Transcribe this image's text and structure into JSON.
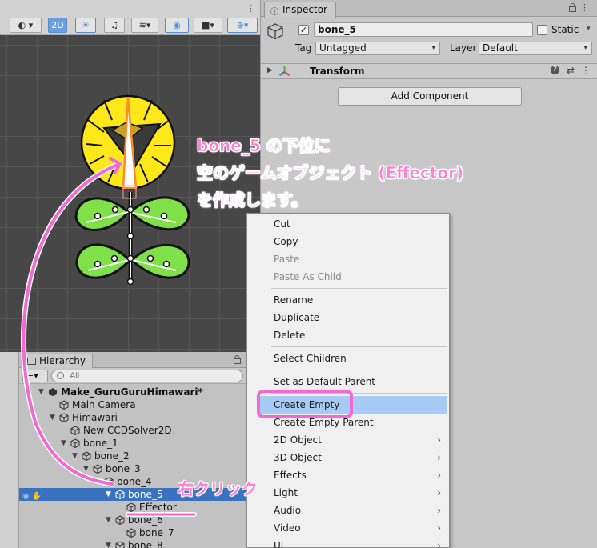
{
  "scene": {
    "toolbar": {
      "shading": "◐",
      "mode_2d": "2D",
      "lighting_icon": "lightbulb-icon",
      "audio_icon": "audio-mute-icon",
      "fx_icon": "effects-icon",
      "hidden_icon": "visibility-icon",
      "camera_icon": "camera-icon",
      "gizmo_icon": "gizmo-icon"
    }
  },
  "inspector": {
    "tab_label": "Inspector",
    "object_name": "bone_5",
    "active_checked": "✓",
    "static_label": "Static",
    "tag_label": "Tag",
    "tag_value": "Untagged",
    "layer_label": "Layer",
    "layer_value": "Default",
    "component_title": "Transform",
    "help_glyph": "?",
    "preset_glyph": "⇄",
    "menu_glyph": "⋮",
    "add_component_label": "Add Component"
  },
  "hierarchy": {
    "tab_label": "Hierarchy",
    "add_label": "+▾",
    "search_placeholder": "All",
    "rows": [
      {
        "label": "Make_GuruGuruHimawari*",
        "depth": 0,
        "expanded": true
      },
      {
        "label": "Main Camera",
        "depth": 1,
        "expanded": null
      },
      {
        "label": "Himawari",
        "depth": 1,
        "expanded": true
      },
      {
        "label": "New CCDSolver2D",
        "depth": 2,
        "expanded": null
      },
      {
        "label": "bone_1",
        "depth": 2,
        "expanded": true
      },
      {
        "label": "bone_2",
        "depth": 3,
        "expanded": true
      },
      {
        "label": "bone_3",
        "depth": 4,
        "expanded": true
      },
      {
        "label": "bone_4",
        "depth": 5,
        "expanded": true
      },
      {
        "label": "bone_5",
        "depth": 6,
        "expanded": true,
        "selected": true
      },
      {
        "label": "Effector",
        "depth": 7,
        "expanded": null
      },
      {
        "label": "bone_6",
        "depth": 6,
        "expanded": true
      },
      {
        "label": "bone_7",
        "depth": 7,
        "expanded": null
      },
      {
        "label": "bone_8",
        "depth": 6,
        "expanded": true
      }
    ]
  },
  "context_menu": {
    "items": [
      {
        "label": "Cut",
        "disabled": false
      },
      {
        "label": "Copy",
        "disabled": false
      },
      {
        "label": "Paste",
        "disabled": true
      },
      {
        "label": "Paste As Child",
        "disabled": true
      },
      {
        "separator": true
      },
      {
        "label": "Rename",
        "disabled": false
      },
      {
        "label": "Duplicate",
        "disabled": false
      },
      {
        "label": "Delete",
        "disabled": false
      },
      {
        "separator": true
      },
      {
        "label": "Select Children",
        "disabled": false
      },
      {
        "separator": true
      },
      {
        "label": "Set as Default Parent",
        "disabled": false
      },
      {
        "separator": true
      },
      {
        "label": "Create Empty",
        "disabled": false,
        "highlighted": true
      },
      {
        "label": "Create Empty Parent",
        "disabled": false
      },
      {
        "label": "2D Object",
        "disabled": false,
        "submenu": true
      },
      {
        "label": "3D Object",
        "disabled": false,
        "submenu": true
      },
      {
        "label": "Effects",
        "disabled": false,
        "submenu": true
      },
      {
        "label": "Light",
        "disabled": false,
        "submenu": true
      },
      {
        "label": "Audio",
        "disabled": false,
        "submenu": true
      },
      {
        "label": "Video",
        "disabled": false,
        "submenu": true
      },
      {
        "label": "UI",
        "disabled": false,
        "submenu": true
      }
    ],
    "submenu_glyph": "›"
  },
  "annotations": {
    "callout_lines": [
      "bone_5 の下位に",
      "空のゲームオブジェクト (Effector)",
      "を作成します。"
    ],
    "right_click_note": "右クリック",
    "accent_color": "#f06ad0"
  }
}
